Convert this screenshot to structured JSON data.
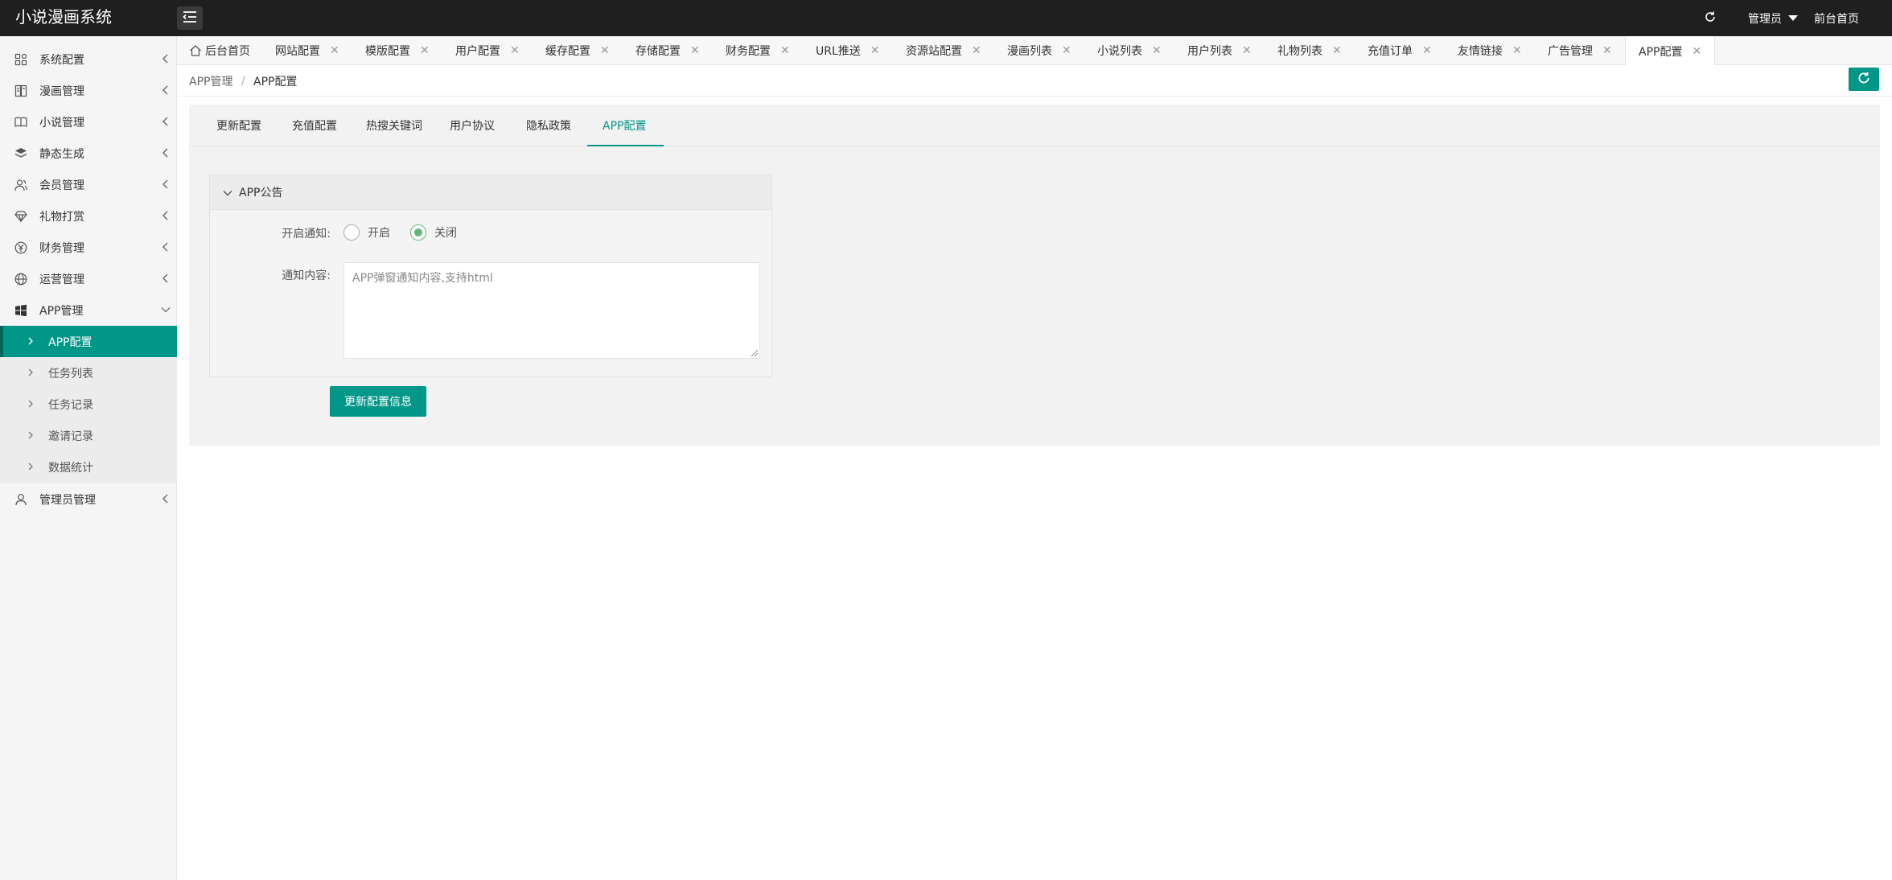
{
  "app": {
    "title": "小说漫画系统"
  },
  "header": {
    "admin_label": "管理员",
    "front_link": "前台首页"
  },
  "sidebar": {
    "items": [
      {
        "label": "系统配置",
        "icon": "settings-icon"
      },
      {
        "label": "漫画管理",
        "icon": "comic-icon"
      },
      {
        "label": "小说管理",
        "icon": "book-icon"
      },
      {
        "label": "静态生成",
        "icon": "layers-icon"
      },
      {
        "label": "会员管理",
        "icon": "user-group-icon"
      },
      {
        "label": "礼物打赏",
        "icon": "diamond-icon"
      },
      {
        "label": "财务管理",
        "icon": "yuan-icon"
      },
      {
        "label": "运营管理",
        "icon": "globe-icon"
      },
      {
        "label": "APP管理",
        "icon": "windows-icon"
      },
      {
        "label": "管理员管理",
        "icon": "person-icon"
      }
    ],
    "app_sub_items": [
      {
        "label": "APP配置",
        "active": true
      },
      {
        "label": "任务列表"
      },
      {
        "label": "任务记录"
      },
      {
        "label": "邀请记录"
      },
      {
        "label": "数据统计"
      }
    ]
  },
  "tabs": [
    {
      "label": "后台首页"
    },
    {
      "label": "网站配置"
    },
    {
      "label": "模版配置"
    },
    {
      "label": "用户配置"
    },
    {
      "label": "缓存配置"
    },
    {
      "label": "存储配置"
    },
    {
      "label": "财务配置"
    },
    {
      "label": "URL推送"
    },
    {
      "label": "资源站配置"
    },
    {
      "label": "漫画列表"
    },
    {
      "label": "小说列表"
    },
    {
      "label": "用户列表"
    },
    {
      "label": "礼物列表"
    },
    {
      "label": "充值订单"
    },
    {
      "label": "友情链接"
    },
    {
      "label": "广告管理"
    },
    {
      "label": "APP配置",
      "active": true
    }
  ],
  "breadcrumb": {
    "parent": "APP管理",
    "separator": "/",
    "current": "APP配置"
  },
  "config_tabs": [
    {
      "label": "更新配置"
    },
    {
      "label": "充值配置"
    },
    {
      "label": "热搜关键词"
    },
    {
      "label": "用户协议"
    },
    {
      "label": "隐私政策"
    },
    {
      "label": "APP配置",
      "active": true
    }
  ],
  "form": {
    "section_title": "APP公告",
    "notify_label": "开启通知:",
    "radio_on": "开启",
    "radio_off": "关闭",
    "notify_selected": "关闭",
    "content_label": "通知内容:",
    "content_value": "",
    "content_placeholder": "APP弹窗通知内容,支持html",
    "submit_label": "更新配置信息"
  },
  "colors": {
    "accent": "#009688",
    "topbar": "#1f1f1f",
    "radio_checked": "#5fb878"
  }
}
